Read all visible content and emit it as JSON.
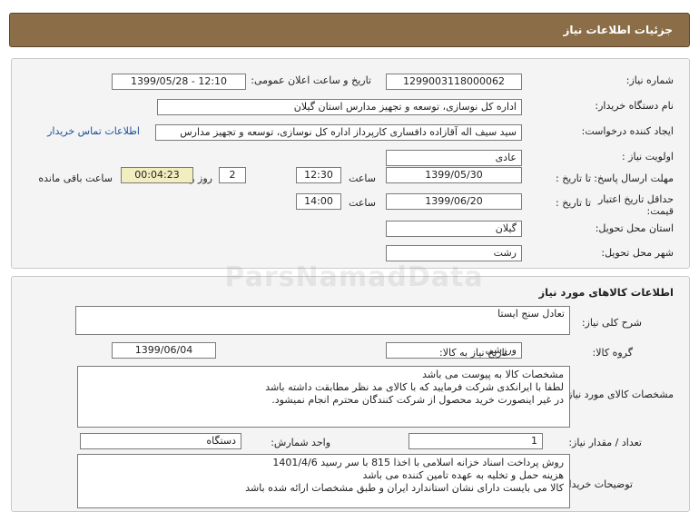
{
  "header": {
    "title": "جزئیات اطلاعات نیاز"
  },
  "info": {
    "need_number_label": "شماره نیاز:",
    "need_number": "1299003118000062",
    "announce_label": "تاریخ و ساعت اعلان عمومی:",
    "announce_value": "1399/05/28 - 12:10",
    "buyer_org_label": "نام دستگاه خریدار:",
    "buyer_org": "اداره کل نوسازی، توسعه و تجهیز مدارس استان گیلان",
    "creator_label": "ایجاد کننده درخواست:",
    "creator": "سید سیف اله آقازاده دافساری کارپرداز اداره کل نوسازی، توسعه و تجهیز مدارس",
    "contact_link": "اطلاعات تماس خریدار",
    "priority_label": "اولویت نیاز :",
    "priority": "عادی",
    "deadline_label": "مهلت ارسال پاسخ:",
    "to_date_label": "تا تاریخ :",
    "deadline_date": "1399/05/30",
    "time_label": "ساعت",
    "deadline_time": "12:30",
    "days_value": "2",
    "days_label": "روز و",
    "remaining_value": "00:04:23",
    "remaining_label": "ساعت باقی مانده",
    "validity_label": "حداقل تاریخ اعتبار قیمت:",
    "validity_to_label": "تا تاریخ :",
    "validity_date": "1399/06/20",
    "validity_time_label": "ساعت",
    "validity_time": "14:00",
    "province_label": "استان محل تحویل:",
    "province": "گیلان",
    "city_label": "شهر محل تحویل:",
    "city": "رشت"
  },
  "goods": {
    "section_title": "اطلاعات کالاهای مورد نیاز",
    "summary_label": "شرح کلی نیاز:",
    "summary": "تعادل سنج ایستا",
    "group_label": "گروه کالا:",
    "group": "ورزشی",
    "need_date_label": "تاریخ نیاز به کالا:",
    "need_date": "1399/06/04",
    "specs_label": "مشخصات کالای مورد نیاز:",
    "specs_lines": [
      "مشخصات کالا به پیوست می باشد",
      "لطفا با ایرانکدی شرکت فرمایید که با کالای مد نظر مطابقت داشته باشد",
      "در غیر اینصورت خرید محصول از شرکت کنندگان محترم انجام نمیشود."
    ],
    "qty_label": "تعداد / مقدار نیاز:",
    "qty": "1",
    "unit_label": "واحد شمارش:",
    "unit": "دستگاه",
    "notes_label": "توضیحات خریدار:",
    "notes_lines": [
      "روش پرداخت اسناد خزانه اسلامی با اخذا 815 با سر رسید 1401/4/6",
      "هزینه حمل و تخلیه به عهده تامین کننده می باشد",
      "کالا می بایست دارای نشان استاندارد ایران و طبق مشخصات ارائه شده باشد"
    ]
  },
  "watermark": {
    "text": "ParsNamadData"
  }
}
